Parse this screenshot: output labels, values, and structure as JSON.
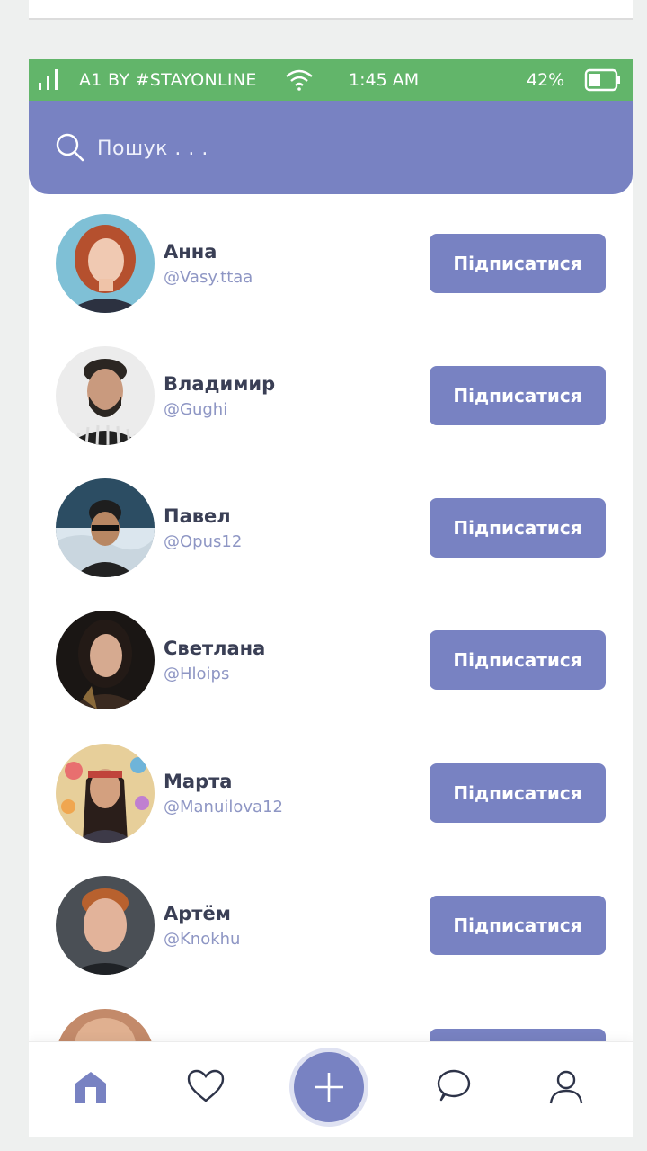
{
  "status_bar": {
    "carrier": "A1 BY #STAYONLINE",
    "time": "1:45 AM",
    "battery": "42%"
  },
  "search": {
    "placeholder": "Пошук . . ."
  },
  "users": [
    {
      "name": "Анна",
      "handle": "@Vasy.ttaa",
      "button": "Підписатися"
    },
    {
      "name": "Владимир",
      "handle": "@Gughi",
      "button": "Підписатися"
    },
    {
      "name": "Павел",
      "handle": "@Opus12",
      "button": "Підписатися"
    },
    {
      "name": "Светлана",
      "handle": "@Hloips",
      "button": "Підписатися"
    },
    {
      "name": "Марта",
      "handle": "@Manuilova12",
      "button": "Підписатися"
    },
    {
      "name": "Артём",
      "handle": "@Knokhu",
      "button": "Підписатися"
    }
  ],
  "nav": {
    "items": [
      "home-icon",
      "heart-icon",
      "plus-icon",
      "chat-icon",
      "profile-icon"
    ]
  },
  "colors": {
    "status_green": "#62b56a",
    "accent": "#7882c2",
    "text_dark": "#3a3f55",
    "handle": "#8e96c4"
  }
}
